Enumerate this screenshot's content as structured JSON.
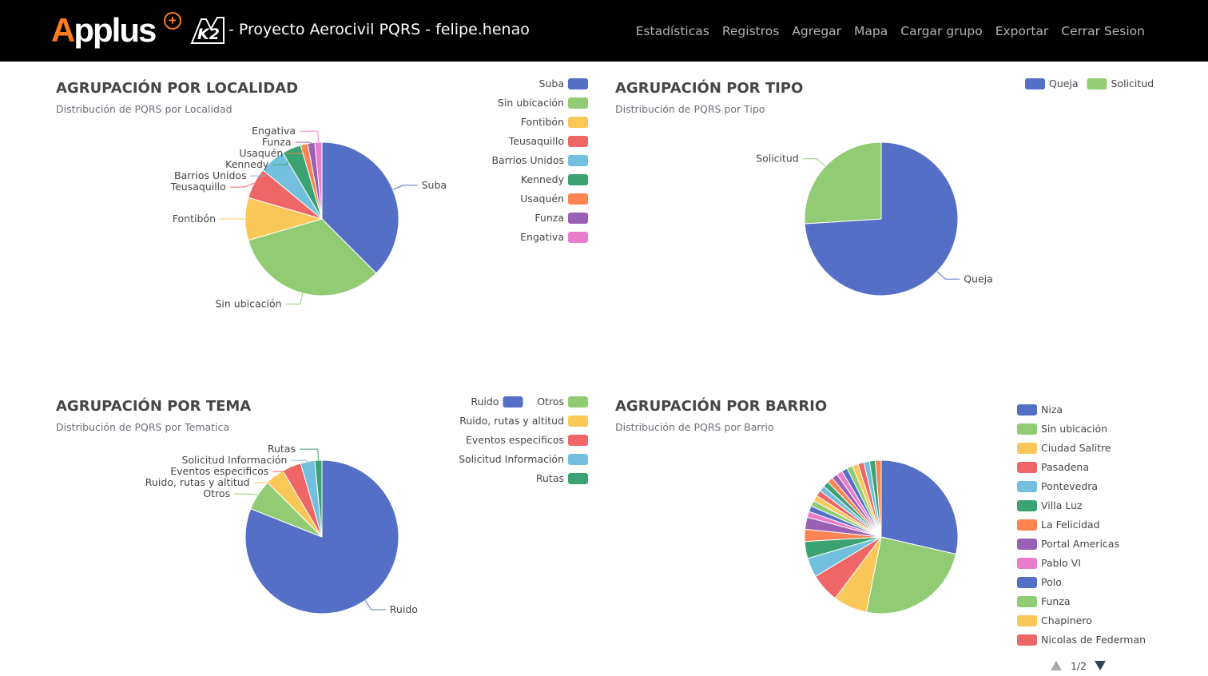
{
  "nav": {
    "brand_a": "A",
    "brand_rest": "pplus",
    "brand_plus": "+",
    "brand_k2": "K2",
    "title": "- Proyecto Aerocivil PQRS - felipe.henao",
    "links": [
      "Estadísticas",
      "Registros",
      "Agregar",
      "Mapa",
      "Cargar grupo",
      "Exportar",
      "Cerrar Sesion"
    ]
  },
  "colors": {
    "palette": [
      "#5470c6",
      "#91cc75",
      "#fac858",
      "#ee6666",
      "#73c0de",
      "#3ba272",
      "#fc8452",
      "#9a60b4",
      "#ea7ccc"
    ],
    "navbar": "#000000",
    "brand": "#ff7c1f"
  },
  "chart_data": [
    {
      "id": "localidad",
      "type": "pie",
      "title": "AGRUPACIÓN POR LOCALIDAD",
      "subtitle": "Distribución de PQRS por Localidad",
      "legend_position": "top-right",
      "slices": [
        {
          "name": "Suba",
          "value": 37.5
        },
        {
          "name": "Sin ubicación",
          "value": 33
        },
        {
          "name": "Fontibón",
          "value": 9
        },
        {
          "name": "Teusaquillo",
          "value": 6.5
        },
        {
          "name": "Barrios Unidos",
          "value": 5.5
        },
        {
          "name": "Kennedy",
          "value": 4
        },
        {
          "name": "Usaquén",
          "value": 1.5
        },
        {
          "name": "Funza",
          "value": 1.5
        },
        {
          "name": "Engativa",
          "value": 1.5
        }
      ]
    },
    {
      "id": "tipo",
      "type": "pie",
      "title": "AGRUPACIÓN POR TIPO",
      "subtitle": "Distribución de PQRS por Tipo",
      "legend_position": "top-right",
      "slices": [
        {
          "name": "Queja",
          "value": 74
        },
        {
          "name": "Solicitud",
          "value": 26
        }
      ]
    },
    {
      "id": "tema",
      "type": "pie",
      "title": "AGRUPACIÓN POR TEMA",
      "subtitle": "Distribución de PQRS por Tematica",
      "legend_position": "top-right",
      "slices": [
        {
          "name": "Ruido",
          "value": 81
        },
        {
          "name": "Otros",
          "value": 6.5
        },
        {
          "name": "Ruido, rutas y altitud",
          "value": 4
        },
        {
          "name": "Eventos especificos",
          "value": 4
        },
        {
          "name": "Solicitud Información",
          "value": 3
        },
        {
          "name": "Rutas",
          "value": 1.5
        }
      ]
    },
    {
      "id": "barrio",
      "type": "pie",
      "title": "AGRUPACIÓN POR BARRIO",
      "subtitle": "Distribución de PQRS por Barrio",
      "legend_position": "right",
      "legend_page": "1/2",
      "slices": [
        {
          "name": "Niza",
          "value": 28
        },
        {
          "name": "Sin ubicación",
          "value": 24
        },
        {
          "name": "Ciudad Salitre",
          "value": 7
        },
        {
          "name": "Pasadena",
          "value": 6
        },
        {
          "name": "Pontevedra",
          "value": 4
        },
        {
          "name": "Villa Luz",
          "value": 3.5
        },
        {
          "name": "La Felicidad",
          "value": 2.5
        },
        {
          "name": "Portal Americas",
          "value": 2.5
        },
        {
          "name": "Pablo VI",
          "value": 1.2
        },
        {
          "name": "Polo",
          "value": 1.2
        },
        {
          "name": "Funza",
          "value": 1.2
        },
        {
          "name": "Chapinero",
          "value": 1.2
        },
        {
          "name": "Nicolas de Federman",
          "value": 1.2
        }
      ],
      "unlabeled_slices": [
        1.2,
        1.2,
        1.2,
        1.2,
        1.2,
        1.2,
        1.2,
        1.2,
        1.2,
        1.2,
        1.2,
        1.2
      ]
    }
  ]
}
